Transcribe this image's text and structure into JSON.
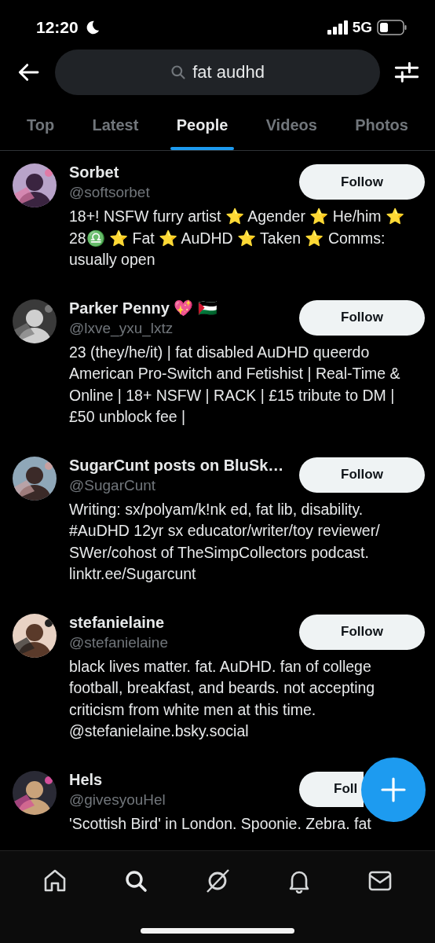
{
  "status_bar": {
    "time": "12:20",
    "network": "5G"
  },
  "search": {
    "value": "fat audhd"
  },
  "tabs": [
    {
      "label": "Top",
      "selected": false
    },
    {
      "label": "Latest",
      "selected": false
    },
    {
      "label": "People",
      "selected": true
    },
    {
      "label": "Videos",
      "selected": false
    },
    {
      "label": "Photos",
      "selected": false
    }
  ],
  "people": [
    {
      "name": "Sorbet",
      "handle": "@softsorbet",
      "bio": "18+! NSFW furry artist ⭐ Agender ⭐ He/him ⭐ 28♎ ⭐ Fat ⭐ AuDHD ⭐ Taken ⭐ Comms: usually open",
      "button": "Follow"
    },
    {
      "name": "Parker Penny 💖 🇵🇸",
      "handle": "@lxve_yxu_lxtz",
      "bio": "23 (they/he/it) | fat disabled AuDHD queerdo American Pro-Switch and Fetishist | Real-Time & Online | 18+ NSFW | RACK | £15 tribute to DM | £50 unblock fee |",
      "button": "Follow"
    },
    {
      "name": "SugarCunt posts on BluSk…",
      "handle": "@SugarCunt",
      "bio": "Writing: sx/polyam/k!nk ed, fat lib, disability. #AuDHD 12yr sx educator/writer/toy reviewer/ SWer/cohost of TheSimpCollectors podcast. linktr.ee/Sugarcunt",
      "button": "Follow"
    },
    {
      "name": "stefanielaine",
      "handle": "@stefanielaine",
      "bio": "black lives matter. fat. AuDHD. fan of college football, breakfast, and beards. not accepting criticism from white men at this time. @stefanielaine.bsky.social",
      "button": "Follow"
    },
    {
      "name": "Hels",
      "handle": "@givesyouHel",
      "bio": "'Scottish Bird' in London. Spoonie. Zebra. fat",
      "button": "Foll"
    }
  ],
  "nav": [
    {
      "kind": "home",
      "selected": false
    },
    {
      "kind": "search",
      "selected": true
    },
    {
      "kind": "grok",
      "selected": false
    },
    {
      "kind": "bell",
      "selected": false
    },
    {
      "kind": "mail",
      "selected": false
    }
  ]
}
